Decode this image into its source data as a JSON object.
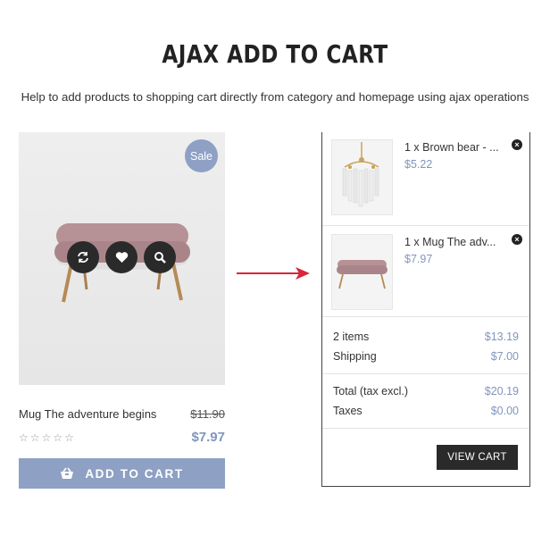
{
  "header": {
    "title": "AJAX ADD TO CART",
    "subtitle": "Help to add products to shopping cart directly from category and homepage using ajax operations"
  },
  "product": {
    "badge": "Sale",
    "name": "Mug The adventure begins",
    "old_price": "$11.90",
    "price": "$7.97",
    "rating": 0,
    "rating_max": 5,
    "add_to_cart_label": "ADD TO CART",
    "image": "sofa-image",
    "quick_actions": [
      "refresh-icon",
      "heart-icon",
      "search-icon"
    ]
  },
  "cart": {
    "items": [
      {
        "name": "1 x Brown bear - ...",
        "price": "$5.22",
        "image": "chandelier-image"
      },
      {
        "name": "1 x Mug The adv...",
        "price": "$7.97",
        "image": "sofa-image"
      }
    ],
    "summary": [
      {
        "label": "2 items",
        "value": "$13.19"
      },
      {
        "label": "Shipping",
        "value": "$7.00"
      }
    ],
    "totals": [
      {
        "label": "Total (tax excl.)",
        "value": "$20.19"
      },
      {
        "label": "Taxes",
        "value": "$0.00"
      }
    ],
    "view_cart_label": "VIEW CART"
  },
  "colors": {
    "accent": "#8ea1c4",
    "price": "#8196bd",
    "dark": "#2a2a2a",
    "arrow": "#d9263a"
  }
}
